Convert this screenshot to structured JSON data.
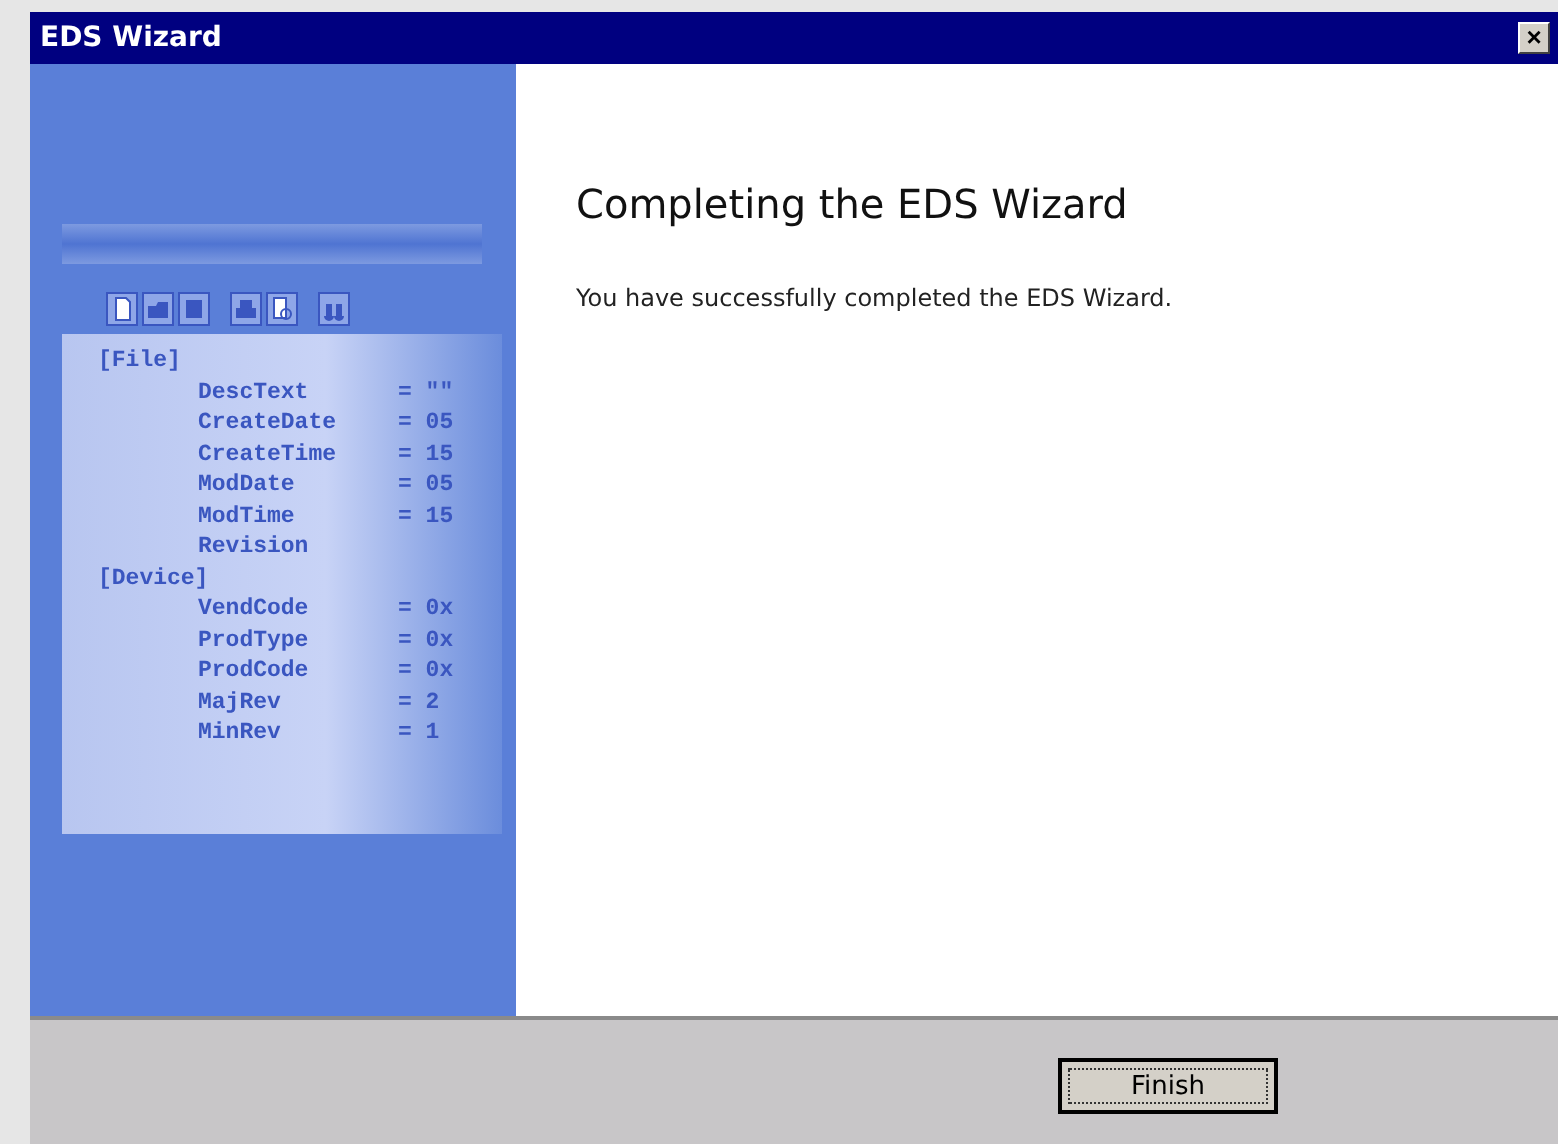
{
  "window": {
    "title": "EDS Wizard",
    "close": "×"
  },
  "listing": {
    "sections": [
      {
        "header": "[File]",
        "entries": [
          {
            "key": "DescText",
            "value": "= \"\""
          },
          {
            "key": "CreateDate",
            "value": "= 05"
          },
          {
            "key": "CreateTime",
            "value": "= 15"
          },
          {
            "key": "ModDate",
            "value": "= 05"
          },
          {
            "key": "ModTime",
            "value": "= 15"
          },
          {
            "key": "Revision"
          }
        ]
      },
      {
        "header": "[Device]",
        "entries": [
          {
            "key": "VendCode",
            "value": "= 0x"
          },
          {
            "key": "ProdType",
            "value": "= 0x"
          },
          {
            "key": "ProdCode",
            "value": "= 0x"
          },
          {
            "key": "MajRev",
            "value": "= 2"
          },
          {
            "key": "MinRev",
            "value": "= 1"
          }
        ]
      }
    ]
  },
  "heading": "Completing the EDS Wizard",
  "message": "You have successfully completed the EDS Wizard.",
  "buttons": [
    "Finish"
  ]
}
